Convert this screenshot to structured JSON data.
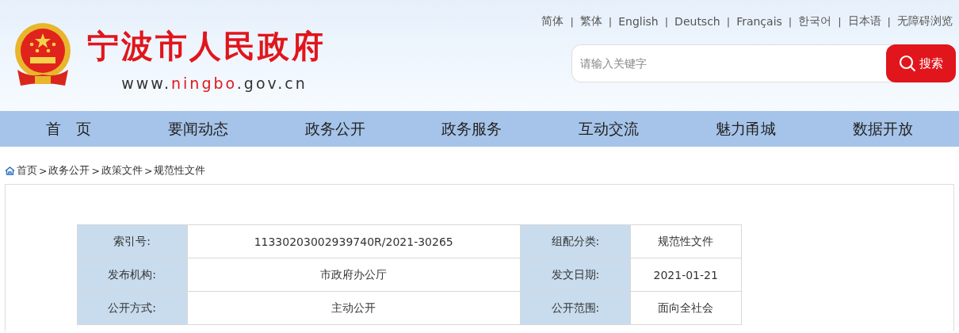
{
  "header": {
    "site_title": "宁波市人民政府",
    "domain_parts": [
      {
        "text": "www.",
        "highlight": false
      },
      {
        "text": "ningbo",
        "highlight": true
      },
      {
        "text": ".gov.cn",
        "highlight": false
      }
    ],
    "top_links": [
      "简体",
      "繁体",
      "English",
      "Deutsch",
      "Français",
      "한국어",
      "日本语",
      "无障碍浏览"
    ],
    "top_link_separator": "|",
    "search": {
      "placeholder": "请输入关键字",
      "button": "搜索"
    }
  },
  "nav": [
    "首　页",
    "要闻动态",
    "政务公开",
    "政务服务",
    "互动交流",
    "魅力甬城",
    "数据开放"
  ],
  "breadcrumb": {
    "items": [
      "首页",
      "政务公开",
      "政策文件",
      "规范性文件"
    ],
    "separator": ">"
  },
  "info_table": [
    {
      "label_1": "索引号:",
      "value_1": "11330203002939740R/2021-30265",
      "label_2": "组配分类:",
      "value_2": "规范性文件"
    },
    {
      "label_1": "发布机构:",
      "value_1": "市政府办公厅",
      "label_2": "发文日期:",
      "value_2": "2021-01-21"
    },
    {
      "label_1": "公开方式:",
      "value_1": "主动公开",
      "label_2": "公开范围:",
      "value_2": "面向全社会"
    }
  ]
}
